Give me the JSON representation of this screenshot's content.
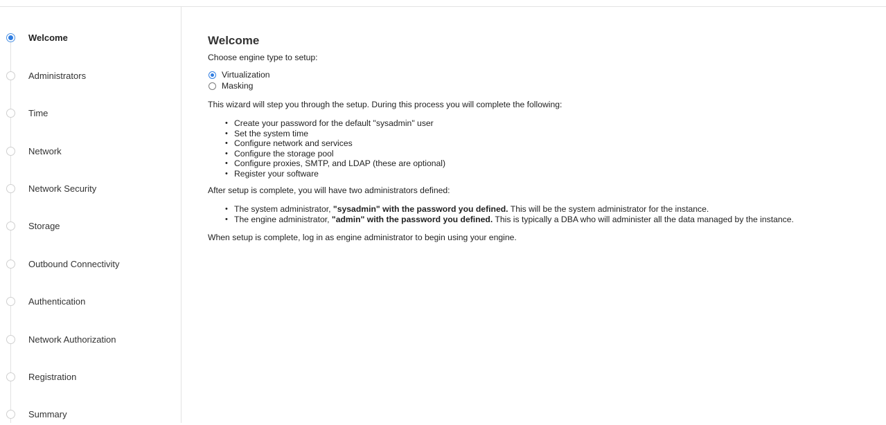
{
  "sidebar": {
    "steps": [
      {
        "label": "Welcome",
        "active": true
      },
      {
        "label": "Administrators",
        "active": false
      },
      {
        "label": "Time",
        "active": false
      },
      {
        "label": "Network",
        "active": false
      },
      {
        "label": "Network Security",
        "active": false
      },
      {
        "label": "Storage",
        "active": false
      },
      {
        "label": "Outbound Connectivity",
        "active": false
      },
      {
        "label": "Authentication",
        "active": false
      },
      {
        "label": "Network Authorization",
        "active": false
      },
      {
        "label": "Registration",
        "active": false
      },
      {
        "label": "Summary",
        "active": false
      }
    ]
  },
  "main": {
    "title": "Welcome",
    "engine_prompt": "Choose engine type to setup:",
    "engine_options": [
      {
        "label": "Virtualization",
        "selected": true
      },
      {
        "label": "Masking",
        "selected": false
      }
    ],
    "intro": "This wizard will step you through the setup. During this process you will complete the following:",
    "tasks": [
      "Create your password for the default \"sysadmin\" user",
      "Set the system time",
      "Configure network and services",
      "Configure the storage pool",
      "Configure proxies, SMTP, and LDAP (these are optional)",
      "Register your software"
    ],
    "admins_intro": "After setup is complete, you will have two administrators defined:",
    "admins": [
      {
        "prefix": "The system administrator, ",
        "bold": "\"sysadmin\" with the password you defined.",
        "suffix": " This will be the system administrator for the instance."
      },
      {
        "prefix": "The engine administrator, ",
        "bold": "\"admin\" with the password you defined.",
        "suffix": " This is typically a DBA who will administer all the data managed by the instance."
      }
    ],
    "outro": "When setup is complete, log in as engine administrator to begin using your engine."
  },
  "colors": {
    "accent": "#2f7de1",
    "divider": "#e3e3e3",
    "text": "#222222"
  }
}
